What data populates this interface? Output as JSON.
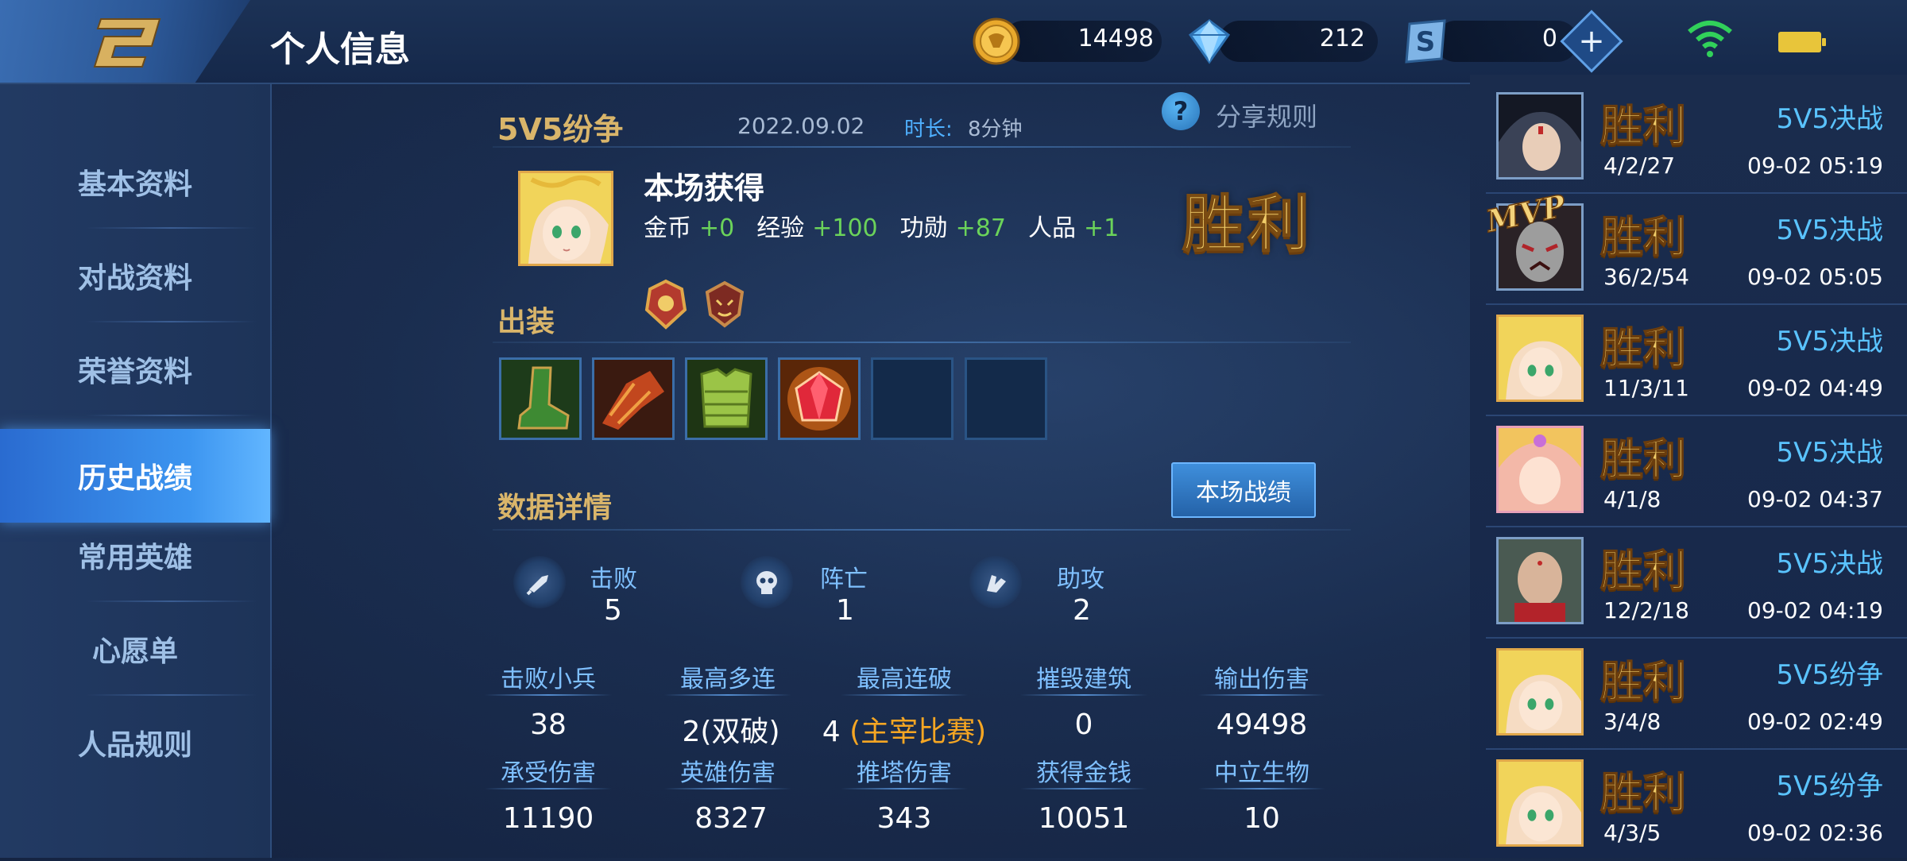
{
  "header": {
    "title": "个人信息",
    "currencies": [
      {
        "icon": "gold-coin-icon",
        "value": "14498"
      },
      {
        "icon": "diamond-icon",
        "value": "212"
      },
      {
        "icon": "voucher-icon",
        "value": "0"
      }
    ],
    "plus_label": "+"
  },
  "sidebar": {
    "items": [
      {
        "label": "基本资料"
      },
      {
        "label": "对战资料"
      },
      {
        "label": "荣誉资料"
      },
      {
        "label": "历史战绩",
        "active": true
      },
      {
        "label": "常用英雄"
      },
      {
        "label": "心愿单"
      },
      {
        "label": "人品规则"
      }
    ]
  },
  "match": {
    "mode": "5V5纷争",
    "date": "2022.09.02",
    "duration_label": "时长:",
    "duration_value": "8分钟",
    "share_label": "分享规则",
    "share_icon": "?",
    "gain_title": "本场获得",
    "gains": [
      {
        "label": "金币",
        "value": "+0"
      },
      {
        "label": "经验",
        "value": "+100"
      },
      {
        "label": "功勋",
        "value": "+87"
      },
      {
        "label": "人品",
        "value": "+1"
      }
    ],
    "result": "胜利",
    "equipment_title": "出装",
    "detail_title": "数据详情",
    "match_button": "本场战绩",
    "kda": [
      {
        "label": "击败",
        "value": "5",
        "icon": "kill-icon"
      },
      {
        "label": "阵亡",
        "value": "1",
        "icon": "skull-icon"
      },
      {
        "label": "助攻",
        "value": "2",
        "icon": "assist-icon"
      }
    ],
    "stats": [
      {
        "label": "击败小兵",
        "value": "38"
      },
      {
        "label": "最高多连",
        "value": "2(双破)"
      },
      {
        "label": "最高连破",
        "value": "4",
        "accent": "(主宰比赛)"
      },
      {
        "label": "摧毁建筑",
        "value": "0"
      },
      {
        "label": "输出伤害",
        "value": "49498"
      },
      {
        "label": "承受伤害",
        "value": "11190"
      },
      {
        "label": "英雄伤害",
        "value": "8327"
      },
      {
        "label": "推塔伤害",
        "value": "343"
      },
      {
        "label": "获得金钱",
        "value": "10051"
      },
      {
        "label": "中立生物",
        "value": "10"
      }
    ]
  },
  "history": [
    {
      "result": "胜利",
      "mode": "5V5决战",
      "kda": "4/2/27",
      "time": "09-02 05:19"
    },
    {
      "result": "胜利",
      "mode": "5V5决战",
      "kda": "36/2/54",
      "time": "09-02 05:05",
      "badge": "MVP"
    },
    {
      "result": "胜利",
      "mode": "5V5决战",
      "kda": "11/3/11",
      "time": "09-02 04:49"
    },
    {
      "result": "胜利",
      "mode": "5V5决战",
      "kda": "4/1/8",
      "time": "09-02 04:37"
    },
    {
      "result": "胜利",
      "mode": "5V5决战",
      "kda": "12/2/18",
      "time": "09-02 04:19"
    },
    {
      "result": "胜利",
      "mode": "5V5纷争",
      "kda": "3/4/8",
      "time": "09-02 02:49"
    },
    {
      "result": "胜利",
      "mode": "5V5纷争",
      "kda": "4/3/5",
      "time": "09-02 02:36"
    }
  ],
  "colors": {
    "accent_blue": "#5ac3ff",
    "gold": "#f0cc68",
    "gain_green": "#6bd35a",
    "highlight_orange": "#f5a623"
  }
}
